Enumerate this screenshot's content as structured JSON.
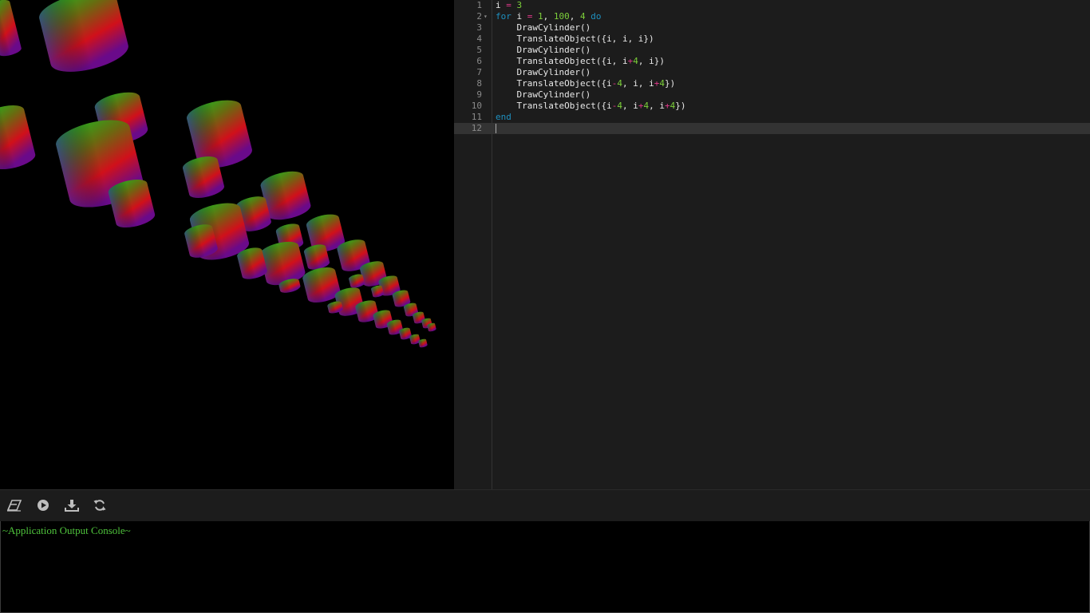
{
  "editor": {
    "lines": [
      {
        "num": "1",
        "fold": "",
        "tokens": [
          [
            "plain",
            "i "
          ],
          [
            "op",
            "="
          ],
          [
            "plain",
            " "
          ],
          [
            "num",
            "3"
          ]
        ]
      },
      {
        "num": "2",
        "fold": "▾",
        "tokens": [
          [
            "kw",
            "for"
          ],
          [
            "plain",
            " i "
          ],
          [
            "op",
            "="
          ],
          [
            "plain",
            " "
          ],
          [
            "num",
            "1"
          ],
          [
            "plain",
            ", "
          ],
          [
            "num",
            "100"
          ],
          [
            "plain",
            ", "
          ],
          [
            "num",
            "4"
          ],
          [
            "plain",
            " "
          ],
          [
            "kw",
            "do"
          ]
        ]
      },
      {
        "num": "3",
        "fold": "",
        "tokens": [
          [
            "plain",
            "    DrawCylinder()"
          ]
        ]
      },
      {
        "num": "4",
        "fold": "",
        "tokens": [
          [
            "plain",
            "    TranslateObject({i, i, i})"
          ]
        ]
      },
      {
        "num": "5",
        "fold": "",
        "tokens": [
          [
            "plain",
            "    DrawCylinder()"
          ]
        ]
      },
      {
        "num": "6",
        "fold": "",
        "tokens": [
          [
            "plain",
            "    TranslateObject({i, i"
          ],
          [
            "op",
            "+"
          ],
          [
            "num",
            "4"
          ],
          [
            "plain",
            ", i})"
          ]
        ]
      },
      {
        "num": "7",
        "fold": "",
        "tokens": [
          [
            "plain",
            "    DrawCylinder()"
          ]
        ]
      },
      {
        "num": "8",
        "fold": "",
        "tokens": [
          [
            "plain",
            "    TranslateObject({i"
          ],
          [
            "op",
            "-"
          ],
          [
            "num",
            "4"
          ],
          [
            "plain",
            ", i, i"
          ],
          [
            "op",
            "+"
          ],
          [
            "num",
            "4"
          ],
          [
            "plain",
            "})"
          ]
        ]
      },
      {
        "num": "9",
        "fold": "",
        "tokens": [
          [
            "plain",
            "    DrawCylinder()"
          ]
        ]
      },
      {
        "num": "10",
        "fold": "",
        "tokens": [
          [
            "plain",
            "    TranslateObject({i"
          ],
          [
            "op",
            "-"
          ],
          [
            "num",
            "4"
          ],
          [
            "plain",
            ", i"
          ],
          [
            "op",
            "+"
          ],
          [
            "num",
            "4"
          ],
          [
            "plain",
            ", i"
          ],
          [
            "op",
            "+"
          ],
          [
            "num",
            "4"
          ],
          [
            "plain",
            "})"
          ]
        ]
      },
      {
        "num": "11",
        "fold": "",
        "tokens": [
          [
            "kw",
            "end"
          ]
        ]
      },
      {
        "num": "12",
        "fold": "",
        "tokens": []
      }
    ],
    "active_line": 12
  },
  "toolbar": {
    "buttons": [
      {
        "name": "clear-button",
        "icon": "eraser-icon"
      },
      {
        "name": "run-button",
        "icon": "play-icon"
      },
      {
        "name": "download-button",
        "icon": "download-icon"
      },
      {
        "name": "refresh-button",
        "icon": "refresh-icon"
      }
    ]
  },
  "console": {
    "title": "~Application Output Console~"
  },
  "colors": {
    "keyword": "#1e8fbe",
    "number": "#7ccf3a",
    "operator": "#e0388a",
    "console_text": "#4fc33c"
  }
}
